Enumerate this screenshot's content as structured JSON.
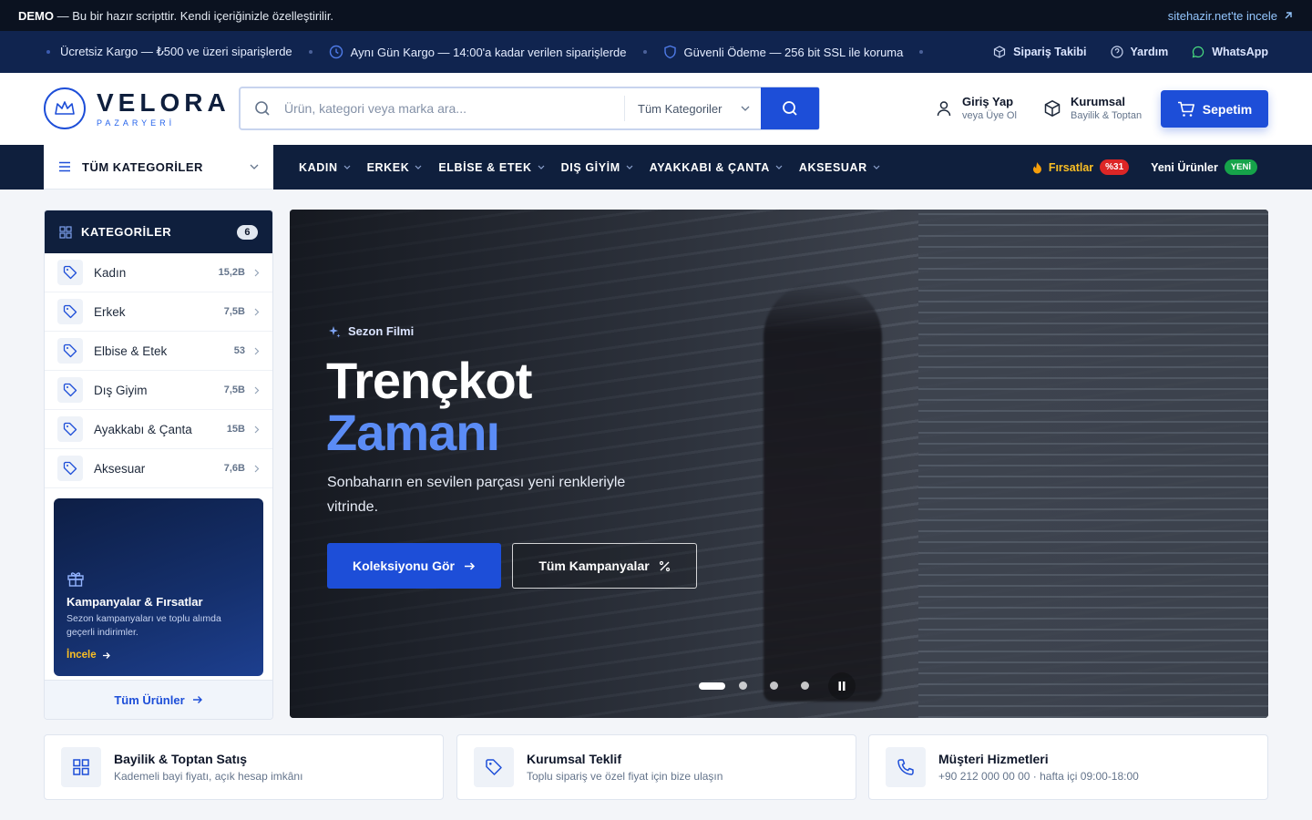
{
  "demo_bar": {
    "tag": "DEMO",
    "text": " — Bu bir hazır scripttir. Kendi içeriğinizle özelleştirilir.",
    "link": "sitehazir.net'te incele"
  },
  "info_bar": {
    "items": [
      "Ücretsiz Kargo — ₺500 ve üzeri siparişlerde",
      "Aynı Gün Kargo — 14:00'a kadar verilen siparişlerde",
      "Güvenli Ödeme — 256 bit SSL ile koruma"
    ],
    "links": [
      "Sipariş Takibi",
      "Yardım",
      "WhatsApp"
    ]
  },
  "brand": {
    "name": "VELORA",
    "sub": "PAZARYERİ"
  },
  "search": {
    "placeholder": "Ürün, kategori veya marka ara...",
    "category": "Tüm Kategoriler"
  },
  "header": {
    "login_title": "Giriş Yap",
    "login_sub": "veya Üye Ol",
    "corp_title": "Kurumsal",
    "corp_sub": "Bayilik & Toptan",
    "cart": "Sepetim"
  },
  "nav": {
    "all_categories": "TÜM KATEGORİLER",
    "items": [
      "KADIN",
      "ERKEK",
      "ELBİSE & ETEK",
      "DIŞ GİYİM",
      "AYAKKABI & ÇANTA",
      "AKSESUAR"
    ],
    "deals": "Fırsatlar",
    "deals_badge": "%31",
    "new": "Yeni Ürünler",
    "new_badge": "YENİ"
  },
  "sidebar": {
    "title": "KATEGORİLER",
    "count": "6",
    "categories": [
      {
        "name": "Kadın",
        "count": "15,2B"
      },
      {
        "name": "Erkek",
        "count": "7,5B"
      },
      {
        "name": "Elbise & Etek",
        "count": "53"
      },
      {
        "name": "Dış Giyim",
        "count": "7,5B"
      },
      {
        "name": "Ayakkabı & Çanta",
        "count": "15B"
      },
      {
        "name": "Aksesuar",
        "count": "7,6B"
      }
    ],
    "promo": {
      "title": "Kampanyalar & Fırsatlar",
      "desc": "Sezon kampanyaları ve toplu alımda geçerli indirimler.",
      "link": "İncele"
    },
    "footer": "Tüm Ürünler"
  },
  "hero": {
    "kicker": "Sezon Filmi",
    "title1": "Trençkot",
    "title2": "Zamanı",
    "subtitle": "Sonbaharın en sevilen parçası yeni renkleriyle vitrinde.",
    "primary_btn": "Koleksiyonu Gör",
    "secondary_btn": "Tüm Kampanyalar"
  },
  "cards": [
    {
      "title": "Bayilik & Toptan Satış",
      "desc": "Kademeli bayi fiyatı, açık hesap imkânı"
    },
    {
      "title": "Kurumsal Teklif",
      "desc": "Toplu sipariş ve özel fiyat için bize ulaşın"
    },
    {
      "title": "Müşteri Hizmetleri",
      "desc": "+90 212 000 00 00 · hafta içi 09:00-18:00"
    }
  ],
  "colors": {
    "accent": "#1d4ed8",
    "navy": "#0f1f3d",
    "hero_accent": "#5b8cf5"
  }
}
